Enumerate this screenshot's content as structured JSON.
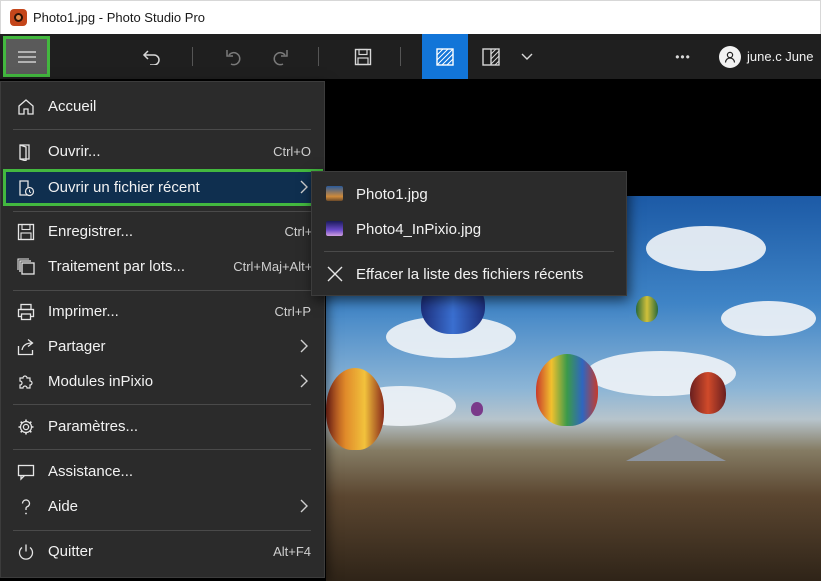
{
  "window": {
    "title": "Photo1.jpg - Photo Studio Pro"
  },
  "toolbar": {
    "user_name": "june.c June",
    "more_label": "•••"
  },
  "menu": {
    "items": [
      {
        "label": "Accueil",
        "shortcut": ""
      },
      {
        "label": "Ouvrir...",
        "shortcut": "Ctrl+O"
      },
      {
        "label": "Ouvrir un fichier récent",
        "shortcut": ""
      },
      {
        "label": "Enregistrer...",
        "shortcut": "Ctrl+S"
      },
      {
        "label": "Traitement par lots...",
        "shortcut": "Ctrl+Maj+Alt+S"
      },
      {
        "label": "Imprimer...",
        "shortcut": "Ctrl+P"
      },
      {
        "label": "Partager",
        "shortcut": ""
      },
      {
        "label": "Modules inPixio",
        "shortcut": ""
      },
      {
        "label": "Paramètres...",
        "shortcut": ""
      },
      {
        "label": "Assistance...",
        "shortcut": ""
      },
      {
        "label": "Aide",
        "shortcut": ""
      },
      {
        "label": "Quitter",
        "shortcut": "Alt+F4"
      }
    ]
  },
  "recent_submenu": {
    "files": [
      {
        "name": "Photo1.jpg"
      },
      {
        "name": "Photo4_InPixio.jpg"
      }
    ],
    "clear_label": "Effacer la liste des fichiers récents"
  },
  "colors": {
    "accent": "#1275d8",
    "highlight_outline": "#43b83f",
    "menu_bg": "#2b2b2b",
    "selected_bg": "#0f2f4f"
  }
}
